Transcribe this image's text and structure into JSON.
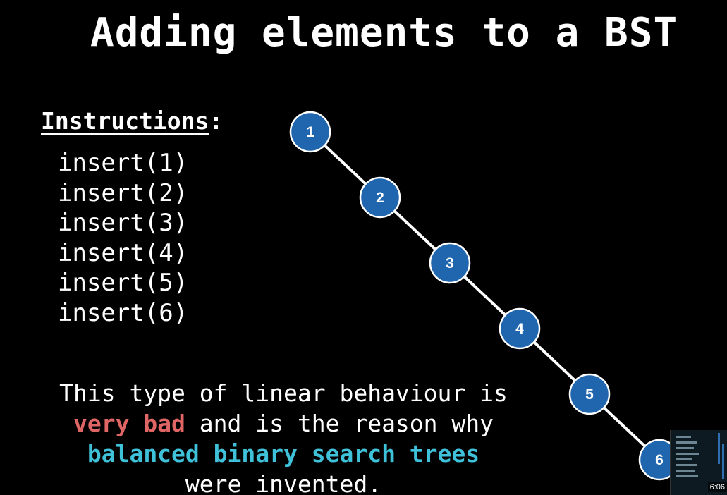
{
  "slide": {
    "title": "Adding elements to a BST",
    "instructions_label": "Instructions",
    "instructions_colon": ":",
    "instructions": [
      "insert(1)",
      "insert(2)",
      "insert(3)",
      "insert(4)",
      "insert(5)",
      "insert(6)"
    ],
    "note": {
      "line1": "This type of linear behaviour is",
      "line2_highlight": "very bad",
      "line2_rest": " and is the reason why",
      "line3_highlight": "balanced binary search trees",
      "line4": "were invented."
    }
  },
  "tree": {
    "nodes": [
      "1",
      "2",
      "3",
      "4",
      "5",
      "6"
    ],
    "edges": [
      [
        "1",
        "2"
      ],
      [
        "2",
        "3"
      ],
      [
        "3",
        "4"
      ],
      [
        "4",
        "5"
      ],
      [
        "5",
        "6"
      ]
    ]
  },
  "colors": {
    "background": "#000000",
    "node_fill": "#2066ae",
    "node_stroke": "#ffffff",
    "edge": "#ffffff",
    "very_bad": "#e06666",
    "balanced": "#3fc1d9"
  },
  "player": {
    "timestamp": "6:06"
  }
}
